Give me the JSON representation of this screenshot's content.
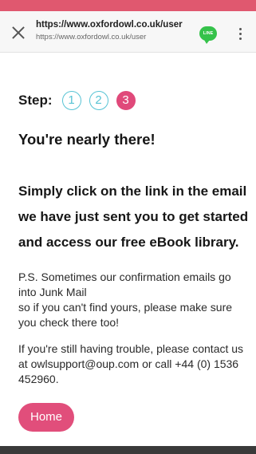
{
  "browser": {
    "url_main": "https://www.oxfordowl.co.uk/user",
    "url_sub": "https://www.oxfordowl.co.uk/user",
    "line_badge": "LINE"
  },
  "steps": {
    "label": "Step:",
    "items": [
      "1",
      "2",
      "3"
    ],
    "active_index": 2
  },
  "content": {
    "heading": "You're nearly there!",
    "lead": "Simply click on the link in the email we have just sent you to get started and access our free eBook library.",
    "note_line1": "P.S. Sometimes our confirmation emails go into Junk Mail",
    "note_line2": "so if you can't find yours, please make sure you check there too!",
    "contact": "If you're still having trouble, please contact us at owlsupport@oup.com or call +44 (0) 1536 452960.",
    "home_button": "Home"
  },
  "colors": {
    "accent_pink": "#e14e7b",
    "step_teal": "#57c3d4",
    "line_green": "#35c24a"
  }
}
